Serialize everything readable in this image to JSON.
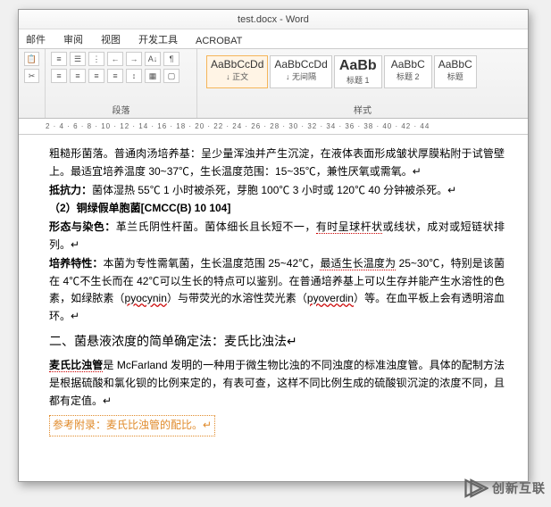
{
  "title": "test.docx - Word",
  "tabs": {
    "t1": "邮件",
    "t2": "审阅",
    "t3": "视图",
    "t4": "开发工具",
    "t5": "ACROBAT"
  },
  "ribbon": {
    "para_label": "段落",
    "style_label": "样式",
    "styles": [
      {
        "sample": "AaBbCcDd",
        "name": "↓ 正文",
        "big": false,
        "active": true
      },
      {
        "sample": "AaBbCcDd",
        "name": "↓ 无间隔",
        "big": false,
        "active": false
      },
      {
        "sample": "AaBb",
        "name": "标题 1",
        "big": true,
        "active": false
      },
      {
        "sample": "AaBbC",
        "name": "标题 2",
        "big": false,
        "active": false
      },
      {
        "sample": "AaBbC",
        "name": "标题",
        "big": false,
        "active": false
      }
    ]
  },
  "ruler": "2 · 4 · 6 · 8 · 10 · 12 · 14 · 16 · 18 · 20 · 22 · 24 · 26 · 28 · 30 · 32 · 34 · 36 · 38 · 40 · 42 · 44",
  "doc": {
    "p0": "粗糙形菌落。普通肉汤培养基：呈少量浑浊并产生沉淀，在液体表面形成皱状厚膜粘附于试管壁上。最适宜培养温度 30~37℃，生长温度范围：15~35℃，兼性厌氧或需氧。↵",
    "p1a": "抵抗力：",
    "p1b": "菌体湿热 55℃ 1 小时被杀死，芽胞 100℃ 3 小时或 120℃ 40 分钟被杀死。↵",
    "p2": "（2）铜绿假单胞菌[CMCC(B) 10 104]",
    "p3a": "形态与染色：",
    "p3b": "革兰氏阴性杆菌。菌体细长且长短不一，",
    "p3c": "有时呈球杆状",
    "p3d": "或线状，成对或短链状排列。↵",
    "p4a": "培养特性：",
    "p4b": "本菌为专性需氧菌，生长温度范围 25~42℃，",
    "p4c": "最适生长温度为",
    "p4d": " 25~30℃，特别是该菌在 4℃不生长而在 42℃可以生长的特点可以鉴别。在普通培养基上可以生存并能产生水溶性的色素，如绿脓素（",
    "p4e": "pyocynin",
    "p4f": "）与带荧光的水溶性荧光素（",
    "p4g": "pyoverdin",
    "p4h": "）等。在血平板上会有透明溶血环。↵",
    "p5": "二、菌悬液浓度的简单确定法：麦氏比浊法↵",
    "p6a": "麦氏比浊管",
    "p6b": "是 McFarland 发明的一种用于微生物比浊的不同浊度的标准浊度管。具体的配制方法是根据硫酸和氯化钡的比例来定的，有表可查，这样不同比例生成的硫酸钡沉淀的浓度不同，且都有定值。↵",
    "p7": "参考附录：麦氏比浊管的配比。↵"
  },
  "watermark": "创新互联"
}
